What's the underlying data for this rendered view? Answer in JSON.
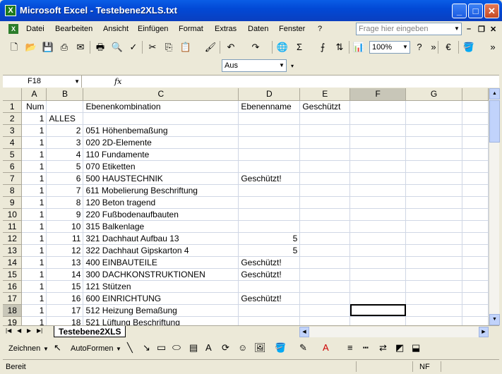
{
  "window": {
    "title": "Microsoft Excel - Testebene2XLS.txt"
  },
  "menu": [
    "Datei",
    "Bearbeiten",
    "Ansicht",
    "Einfügen",
    "Format",
    "Extras",
    "Daten",
    "Fenster",
    "?"
  ],
  "help_box": {
    "placeholder": "Frage hier eingeben"
  },
  "toolbar": {
    "zoom": "100%",
    "currency_icon": "€"
  },
  "style_box": {
    "value": "Aus"
  },
  "formula_bar": {
    "name_box": "F18",
    "fx": "fx",
    "content": ""
  },
  "sheet": {
    "columns": [
      "A",
      "B",
      "C",
      "D",
      "E",
      "F",
      "G"
    ],
    "rows": [
      {
        "n": "1",
        "A": "Num",
        "B": "",
        "C": "Ebenenkombination",
        "D": "Ebenenname",
        "E": "Geschützt"
      },
      {
        "n": "2",
        "A": "1",
        "B": "ALLES",
        "C": "",
        "D": "",
        "E": ""
      },
      {
        "n": "3",
        "A": "1",
        "B": "2",
        "C": "051 Höhenbemaßung",
        "D": "",
        "E": ""
      },
      {
        "n": "4",
        "A": "1",
        "B": "3",
        "C": "020 2D-Elemente",
        "D": "",
        "E": ""
      },
      {
        "n": "5",
        "A": "1",
        "B": "4",
        "C": "110 Fundamente",
        "D": "",
        "E": ""
      },
      {
        "n": "6",
        "A": "1",
        "B": "5",
        "C": "070 Etiketten",
        "D": "",
        "E": ""
      },
      {
        "n": "7",
        "A": "1",
        "B": "6",
        "C": "500 HAUSTECHNIK",
        "D": "Geschützt!",
        "E": ""
      },
      {
        "n": "8",
        "A": "1",
        "B": "7",
        "C": "611 Mobelierung Beschriftung",
        "D": "",
        "E": ""
      },
      {
        "n": "9",
        "A": "1",
        "B": "8",
        "C": "120 Beton tragend",
        "D": "",
        "E": ""
      },
      {
        "n": "10",
        "A": "1",
        "B": "9",
        "C": "220 Fußbodenaufbauten",
        "D": "",
        "E": ""
      },
      {
        "n": "11",
        "A": "1",
        "B": "10",
        "C": "315 Balkenlage",
        "D": "",
        "E": ""
      },
      {
        "n": "12",
        "A": "1",
        "B": "11",
        "C": "321 Dachhaut Aufbau 13",
        "D": "5",
        "E": ""
      },
      {
        "n": "13",
        "A": "1",
        "B": "12",
        "C": "322 Dachhaut Gipskarton 4",
        "D": "5",
        "E": ""
      },
      {
        "n": "14",
        "A": "1",
        "B": "13",
        "C": "400 EINBAUTEILE",
        "D": "Geschützt!",
        "E": ""
      },
      {
        "n": "15",
        "A": "1",
        "B": "14",
        "C": "300 DACHKONSTRUKTIONEN",
        "D": "Geschützt!",
        "E": ""
      },
      {
        "n": "16",
        "A": "1",
        "B": "15",
        "C": "121 Stützen",
        "D": "",
        "E": ""
      },
      {
        "n": "17",
        "A": "1",
        "B": "16",
        "C": "600 EINRICHTUNG",
        "D": "Geschützt!",
        "E": ""
      },
      {
        "n": "18",
        "A": "1",
        "B": "17",
        "C": "512 Heizung Bemaßung",
        "D": "",
        "E": ""
      },
      {
        "n": "19",
        "A": "1",
        "B": "18",
        "C": "521 Lüftung Beschriftung",
        "D": "",
        "E": ""
      }
    ],
    "selected_cell": "F18"
  },
  "sheet_tab": {
    "name": "Testebene2XLS"
  },
  "drawing": {
    "zeichnen": "Zeichnen",
    "autoformen": "AutoFormen"
  },
  "status": {
    "left": "Bereit",
    "mode": "NF"
  }
}
